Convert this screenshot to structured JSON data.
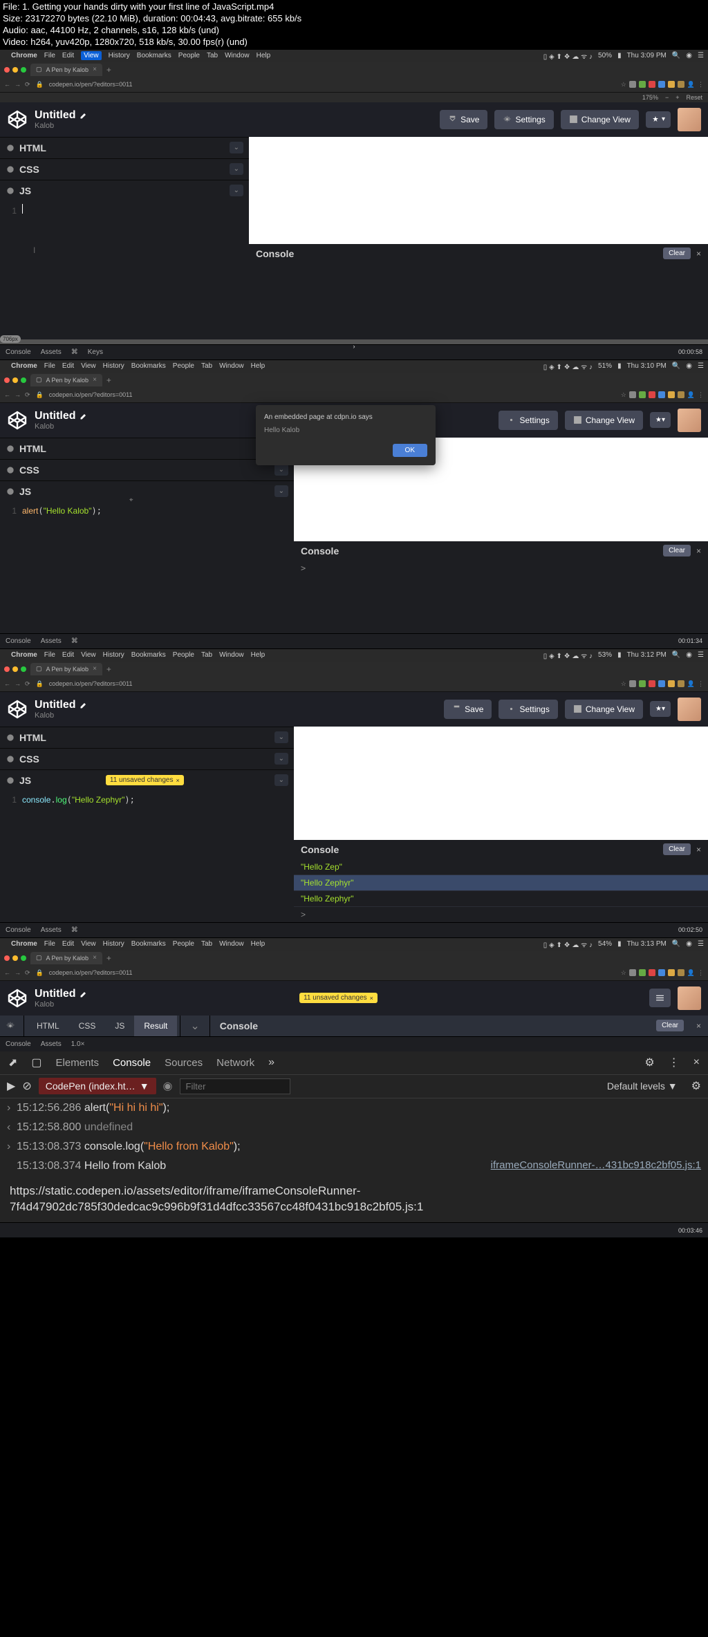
{
  "fileinfo": {
    "line1": "File: 1. Getting your hands dirty with your first line of JavaScript.mp4",
    "line2": "Size: 23172270 bytes (22.10 MiB), duration: 00:04:43, avg.bitrate: 655 kb/s",
    "line3": "Audio: aac, 44100 Hz, 2 channels, s16, 128 kb/s (und)",
    "line4": "Video: h264, yuv420p, 1280x720, 518 kb/s, 30.00 fps(r) (und)"
  },
  "menubar": {
    "app": "Chrome",
    "items": [
      "File",
      "Edit",
      "View",
      "History",
      "Bookmarks",
      "People",
      "Tab",
      "Window",
      "Help"
    ]
  },
  "frames": [
    {
      "time": "Thu 3:09 PM",
      "battery": "50%",
      "ts": "00:00:58",
      "tab": "A Pen by Kalob",
      "url": "codepen.io/pen/?editors=0011",
      "title": "Untitled",
      "author": "Kalob",
      "zoom": "175%",
      "zoomreset": "Reset",
      "btns": {
        "save": "Save",
        "settings": "Settings",
        "changeview": "Change View"
      },
      "panes": {
        "html": "HTML",
        "css": "CSS",
        "js": "JS"
      },
      "console": "Console",
      "clear": "Clear",
      "bottom": {
        "console": "Console",
        "assets": "Assets",
        "keys": "Keys"
      },
      "splitter": "706px"
    },
    {
      "time": "Thu 3:10 PM",
      "battery": "51%",
      "ts": "00:01:34",
      "tab": "A Pen by Kalob",
      "url": "codepen.io/pen/?editors=0011",
      "title": "Untitled",
      "author": "Kalob",
      "btns": {
        "settings": "Settings",
        "changeview": "Change View"
      },
      "panes": {
        "html": "HTML",
        "css": "CSS",
        "js": "JS"
      },
      "code": "alert(\"Hello Kalob\");",
      "alert": {
        "title": "An embedded page at cdpn.io says",
        "msg": "Hello Kalob",
        "ok": "OK"
      },
      "console": "Console",
      "clear": "Clear",
      "bottom": {
        "console": "Console",
        "assets": "Assets"
      }
    },
    {
      "time": "Thu 3:12 PM",
      "battery": "53%",
      "ts": "00:02:50",
      "tab": "A Pen by Kalob",
      "url": "codepen.io/pen/?editors=0011",
      "title": "Untitled",
      "author": "Kalob",
      "btns": {
        "save": "Save",
        "settings": "Settings",
        "changeview": "Change View"
      },
      "panes": {
        "html": "HTML",
        "css": "CSS",
        "js": "JS"
      },
      "badge": "11 unsaved changes",
      "code": "console.log(\"Hello Zephyr\");",
      "console": "Console",
      "clear": "Clear",
      "out": [
        "\"Hello Zep\"",
        "\"Hello Zephyr\"",
        "\"Hello Zephyr\""
      ],
      "bottom": {
        "console": "Console",
        "assets": "Assets"
      }
    },
    {
      "time": "Thu 3:13 PM",
      "battery": "54%",
      "ts": "00:03:46",
      "tab": "A Pen by Kalob",
      "url": "codepen.io/pen/?editors=0011",
      "title": "Untitled",
      "author": "Kalob",
      "badge": "11 unsaved changes",
      "tabs": {
        "html": "HTML",
        "css": "CSS",
        "js": "JS",
        "result": "Result"
      },
      "console": "Console",
      "clear": "Clear",
      "bottom": {
        "console": "Console",
        "assets": "Assets",
        "scale": "1.0×"
      },
      "devtools": {
        "tabs": [
          "Elements",
          "Console",
          "Sources",
          "Network"
        ],
        "context": "CodePen (index.ht…",
        "filter_ph": "Filter",
        "levels": "Default levels",
        "logs": [
          {
            "dir": ">",
            "ts": "15:12:56.286",
            "code": "alert(\"Hi hi hi hi\");"
          },
          {
            "dir": "<",
            "ts": "15:12:58.800",
            "code": "undefined"
          },
          {
            "dir": ">",
            "ts": "15:13:08.373",
            "code": "console.log(\"Hello from Kalob\");"
          },
          {
            "dir": " ",
            "ts": "15:13:08.374",
            "code": "Hello from Kalob",
            "link": "iframeConsoleRunner-…431bc918c2bf05.js:1"
          }
        ],
        "url": "https://static.codepen.io/assets/editor/iframe/iframeConsoleRunner-7f4d47902dc785f30dedcac9c996b9f31d4dfcc33567cc48f0431bc918c2bf05.js:1"
      }
    }
  ]
}
